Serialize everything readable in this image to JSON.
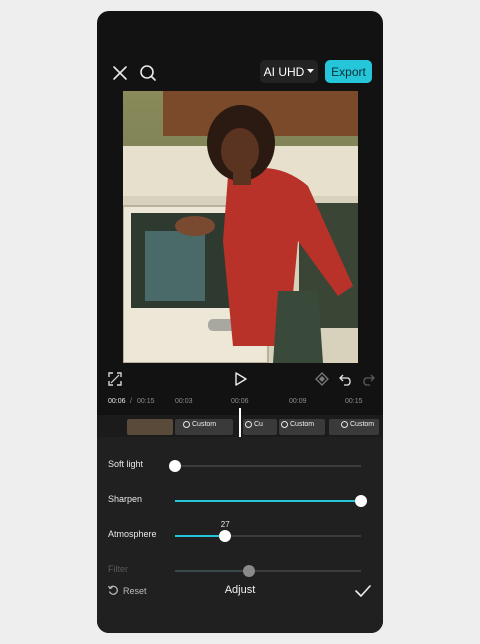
{
  "topbar": {
    "close_icon": "close-icon",
    "search_icon": "search-icon",
    "quality_label": "AI UHD",
    "export_label": "Export"
  },
  "controls": {
    "fullscreen_icon": "fullscreen-icon",
    "play_icon": "play-icon",
    "keyframe_icon": "keyframe-icon",
    "undo_icon": "undo-icon",
    "redo_icon": "redo-icon"
  },
  "timeline": {
    "current_time": "00:06",
    "total_time": "00:15",
    "marks": [
      "00:03",
      "00:06",
      "00:09",
      "00:15"
    ],
    "clip_tags": [
      "Custom",
      "Cu",
      "Custom",
      "Custom"
    ]
  },
  "adjust": {
    "title": "Adjust",
    "reset_label": "Reset",
    "sliders": [
      {
        "label": "Soft light",
        "value": 0,
        "value_text": ""
      },
      {
        "label": "Sharpen",
        "value": 100,
        "value_text": ""
      },
      {
        "label": "Atmosphere",
        "value": 27,
        "value_text": "27"
      },
      {
        "label": "Filter",
        "value": 40,
        "value_text": ""
      }
    ]
  },
  "colors": {
    "accent": "#26c6da",
    "background": "#121212",
    "panel": "#202020"
  }
}
